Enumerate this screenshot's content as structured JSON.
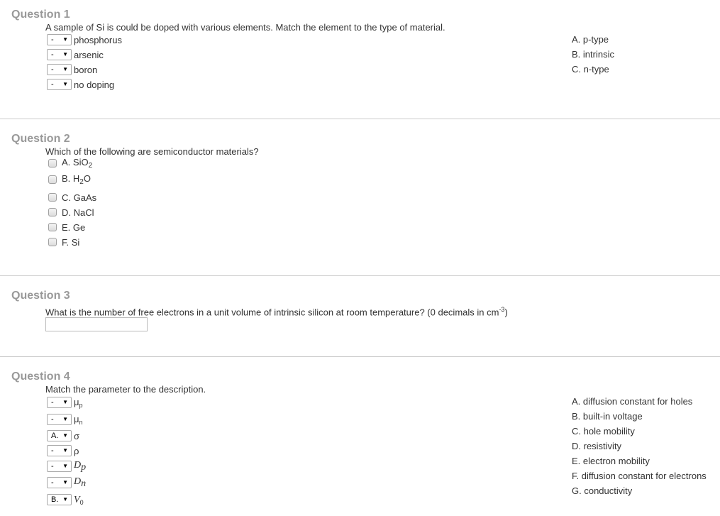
{
  "q1": {
    "title": "Question 1",
    "text": "A sample of Si is could be doped with various elements. Match the element to the type of material.",
    "rows": [
      {
        "selected": "-",
        "label": "phosphorus"
      },
      {
        "selected": "-",
        "label": "arsenic"
      },
      {
        "selected": "-",
        "label": "boron"
      },
      {
        "selected": "-",
        "label": "no doping"
      }
    ],
    "options": [
      "A. p-type",
      "B. intrinsic",
      "C. n-type"
    ]
  },
  "q2": {
    "title": "Question 2",
    "text": "Which of the following are semiconductor materials?",
    "choices": [
      {
        "prefix": "A. SiO",
        "sub": "2",
        "suffix": "",
        "checked": false
      },
      {
        "prefix": "B. H",
        "sub": "2",
        "suffix": "O",
        "checked": false
      },
      {
        "prefix": "C. GaAs",
        "sub": "",
        "suffix": "",
        "checked": false
      },
      {
        "prefix": "D. NaCl",
        "sub": "",
        "suffix": "",
        "checked": false
      },
      {
        "prefix": "E. Ge",
        "sub": "",
        "suffix": "",
        "checked": false
      },
      {
        "prefix": "F. Si",
        "sub": "",
        "suffix": "",
        "checked": false
      }
    ]
  },
  "q3": {
    "title": "Question 3",
    "text": "What is the number of free electrons in a unit volume of intrinsic silicon at room temperature? (0 decimals in cm",
    "text_sup": "-3",
    "text_end": ")",
    "answer": ""
  },
  "q4": {
    "title": "Question 4",
    "text": "Match the parameter to the description.",
    "rows": [
      {
        "selected": "-",
        "sym": "μ",
        "sub": "p"
      },
      {
        "selected": "-",
        "sym": "μ",
        "sub": "n"
      },
      {
        "selected": "A.",
        "sym": "σ",
        "sub": ""
      },
      {
        "selected": "-",
        "sym": "ρ",
        "sub": ""
      },
      {
        "selected": "-",
        "sym": "D",
        "sub": "p"
      },
      {
        "selected": "-",
        "sym": "D",
        "sub": "n"
      },
      {
        "selected": "B.",
        "sym": "V",
        "sub": "0"
      }
    ],
    "options": [
      "A. diffusion constant for holes",
      "B. built-in voltage",
      "C. hole mobility",
      "D. resistivity",
      "E. electron mobility",
      "F. diffusion constant for electrons",
      "G. conductivity"
    ]
  },
  "ui": {
    "arrow": "▼"
  }
}
